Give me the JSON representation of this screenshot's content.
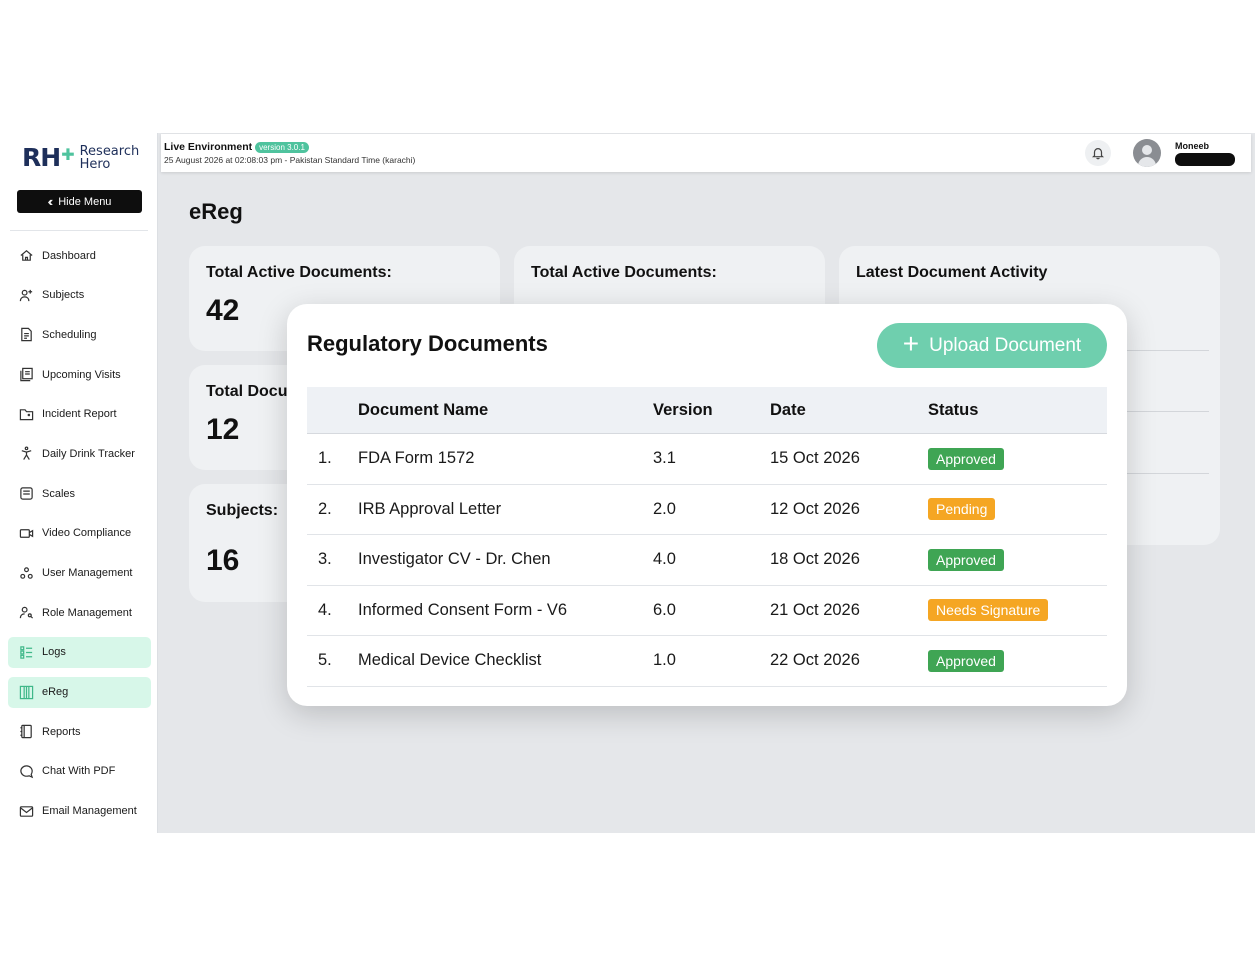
{
  "colors": {
    "accent": "#4fc39e",
    "approved": "#3fa554",
    "pending": "#f5a623",
    "needs_signature": "#f5a623"
  },
  "brand": {
    "mark": "RH",
    "line1": "Research",
    "line2": "Hero"
  },
  "sidebar": {
    "hide_menu_label": "Hide Menu",
    "items": [
      {
        "label": "Dashboard",
        "icon": "home-icon"
      },
      {
        "label": "Subjects",
        "icon": "user-plus-icon"
      },
      {
        "label": "Scheduling",
        "icon": "document-icon"
      },
      {
        "label": "Upcoming Visits",
        "icon": "stack-icon"
      },
      {
        "label": "Incident Report",
        "icon": "folder-icon"
      },
      {
        "label": "Daily Drink Tracker",
        "icon": "person-icon"
      },
      {
        "label": "Scales",
        "icon": "scale-icon"
      },
      {
        "label": "Video Compliance",
        "icon": "video-icon"
      },
      {
        "label": "User Management",
        "icon": "users-icon"
      },
      {
        "label": "Role Management",
        "icon": "user-key-icon"
      },
      {
        "label": "Logs",
        "icon": "list-icon"
      },
      {
        "label": "eReg",
        "icon": "columns-icon"
      },
      {
        "label": "Reports",
        "icon": "book-icon"
      },
      {
        "label": "Chat With PDF",
        "icon": "chat-icon"
      },
      {
        "label": "Email Management",
        "icon": "mail-icon"
      }
    ]
  },
  "topbar": {
    "environment": "Live Environment",
    "version": "version 3.0.1",
    "datetime": "25 August 2026 at 02:08:03 pm - Pakistan Standard Time (karachi)",
    "username": "Moneeb"
  },
  "page": {
    "title": "eReg",
    "cards": {
      "active1_title": "Total Active Documents:",
      "active1_value": "42",
      "active2_title": "Total Active Documents:",
      "total_docs_title": "Total Docu",
      "total_docs_value": "12",
      "subjects_title": "Subjects:",
      "subjects_value": "16",
      "activity_title": "Latest Document Activity"
    }
  },
  "modal": {
    "title": "Regulatory Documents",
    "upload_label": "Upload Document",
    "headers": {
      "name": "Document Name",
      "version": "Version",
      "date": "Date",
      "status": "Status"
    },
    "rows": [
      {
        "num": "1.",
        "name": "FDA Form 1572",
        "version": "3.1",
        "date": "15 Oct 2026",
        "status": "Approved"
      },
      {
        "num": "2.",
        "name": "IRB Approval Letter",
        "version": "2.0",
        "date": "12 Oct 2026",
        "status": "Pending"
      },
      {
        "num": "3.",
        "name": "Investigator CV - Dr. Chen",
        "version": "4.0",
        "date": "18 Oct 2026",
        "status": "Approved"
      },
      {
        "num": "4.",
        "name": "Informed Consent Form - V6",
        "version": "6.0",
        "date": "21 Oct 2026",
        "status": "Needs Signature"
      },
      {
        "num": "5.",
        "name": "Medical Device Checklist",
        "version": "1.0",
        "date": "22 Oct 2026",
        "status": "Approved"
      }
    ]
  }
}
